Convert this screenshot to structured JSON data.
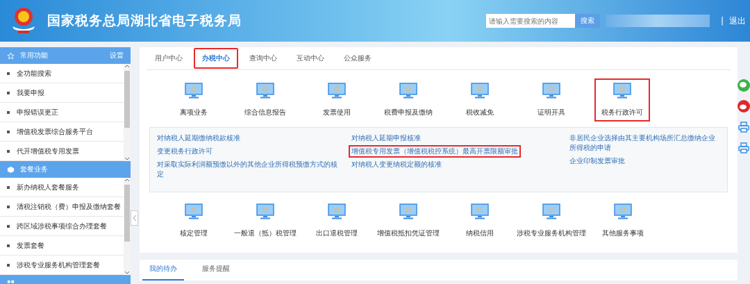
{
  "header": {
    "title": "国家税务总局湖北省电子税务局",
    "search": {
      "placeholder": "请输入需要搜索的内容"
    },
    "search_button": "搜索",
    "separator": "|",
    "logout": "退出"
  },
  "sidebar": {
    "sections": [
      {
        "title": "常用功能",
        "action": "设置",
        "kind": "star",
        "items": [
          "全功能搜索",
          "我要申报",
          "申报错误更正",
          "增值税发票综合服务平台",
          "代开增值税专用发票"
        ]
      },
      {
        "title": "套餐业务",
        "kind": "cube",
        "items": [
          "新办纳税人套餐服务",
          "清税注销税（费）申报及缴纳套餐",
          "跨区域涉税事项综合办理套餐",
          "发票套餐",
          "涉税专业服务机构管理套餐"
        ]
      },
      {
        "kind": "grid"
      }
    ]
  },
  "tabs": [
    {
      "label": "用户中心",
      "selected": false,
      "highlighted": false
    },
    {
      "label": "办税中心",
      "selected": true,
      "highlighted": true
    },
    {
      "label": "查询中心",
      "selected": false,
      "highlighted": false
    },
    {
      "label": "互动中心",
      "selected": false,
      "highlighted": false
    },
    {
      "label": "公众服务",
      "selected": false,
      "highlighted": false
    }
  ],
  "services_row1": [
    {
      "label": "离项业务",
      "highlighted": false
    },
    {
      "label": "综合信息报告",
      "highlighted": false
    },
    {
      "label": "发票使用",
      "highlighted": false
    },
    {
      "label": "税费申报及缴纳",
      "highlighted": false
    },
    {
      "label": "税收减免",
      "highlighted": false
    },
    {
      "label": "证明开具",
      "highlighted": false
    },
    {
      "label": "税务行政许可",
      "highlighted": true
    }
  ],
  "links": [
    [
      {
        "label": "对纳税人延期缴纳税款核准",
        "highlighted": false
      },
      {
        "label": "变更税务行政许可",
        "highlighted": false
      },
      {
        "label": "对采取实际利润额预缴以外的其他企业所得税预缴方式的核定",
        "highlighted": false
      }
    ],
    [
      {
        "label": "对纳税人延期申报核准",
        "highlighted": false
      },
      {
        "label": "增值税专用发票（增值税税控系统）最高开票限额审批",
        "highlighted": true
      },
      {
        "label": "对纳税人变更纳税定额的核准",
        "highlighted": false
      }
    ],
    [
      {
        "label": "非居民企业选择由其主要机构场所汇总缴纳企业所得税的申请",
        "highlighted": false
      },
      {
        "label": "企业印制发票审批",
        "highlighted": false
      }
    ]
  ],
  "services_row2": [
    {
      "label": "核定管理",
      "highlighted": false
    },
    {
      "label": "一般退（抵）税管理",
      "highlighted": false
    },
    {
      "label": "出口退税管理",
      "highlighted": false
    },
    {
      "label": "增值税抵扣凭证管理",
      "highlighted": false
    },
    {
      "label": "纳税信用",
      "highlighted": false
    },
    {
      "label": "涉税专业服务机构管理",
      "highlighted": false
    },
    {
      "label": "其他服务事项",
      "highlighted": false
    }
  ],
  "bottom_tabs": [
    {
      "label": "我的待办",
      "selected": true
    },
    {
      "label": "服务提醒",
      "selected": false
    }
  ]
}
